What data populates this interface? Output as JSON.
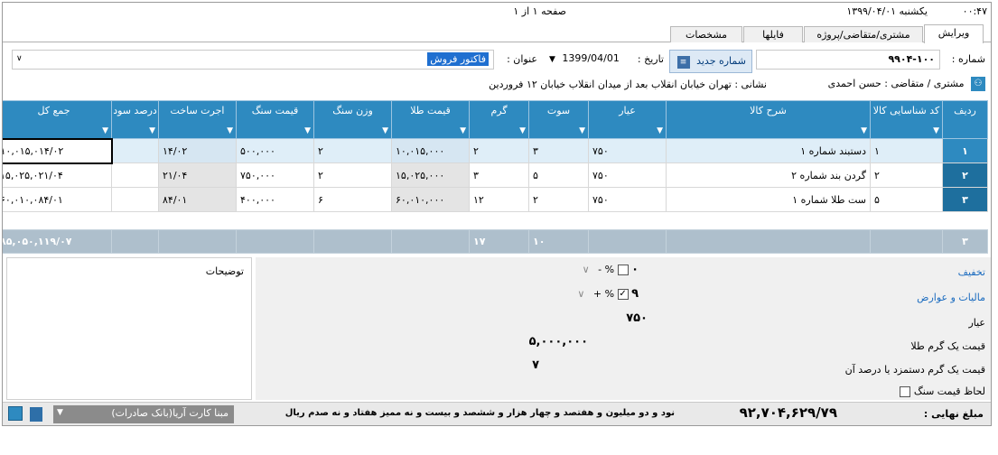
{
  "header": {
    "time": "۰۰:۴۷",
    "date": "یکشنبه ۱۳۹۹/۰۴/۰۱",
    "pager": "صفحه ۱ از ۱"
  },
  "tabs": [
    {
      "label": "ویرایش",
      "active": true
    },
    {
      "label": "مشتری/متقاضی/پروژه",
      "active": false
    },
    {
      "label": "فایلها",
      "active": false
    },
    {
      "label": "مشخصات",
      "active": false
    }
  ],
  "form": {
    "number_label": "شماره :",
    "number_value": "۹۹۰۴-۱۰۰",
    "new_number_button": "شماره جدید",
    "date_label": "تاریخ :",
    "date_value": "1399/04/01",
    "title_label": "عنوان :",
    "title_value": "فاکتور فروش",
    "customer_label": "مشتری / متقاضی : حسن احمدی",
    "address": "نشانی : تهران خیابان انقلاب بعد از میدان انقلاب خیابان ۱۲ فروردین"
  },
  "table": {
    "columns": [
      "ردیف",
      "کد شناسایی کالا",
      "شرح کالا",
      "عیار",
      "سوت",
      "گرم",
      "قیمت طلا",
      "وزن سنگ",
      "قیمت سنگ",
      "اجرت ساخت",
      "درصد سود",
      "جمع کل"
    ],
    "rows": [
      {
        "idx": "۱",
        "code": "۱",
        "desc": "دستبند شماره ۱",
        "ayar": "۷۵۰",
        "sot": "۳",
        "gram": "۲",
        "gold_price": "۱۰,۰۱۵,۰۰۰",
        "stone_weight": "۲",
        "stone_price": "۵۰۰,۰۰۰",
        "wage": "۱۴/۰۲",
        "profit": "",
        "total": "۱۰,۰۱۵,۰۱۴/۰۲"
      },
      {
        "idx": "۲",
        "code": "۲",
        "desc": "گردن بند شماره ۲",
        "ayar": "۷۵۰",
        "sot": "۵",
        "gram": "۳",
        "gold_price": "۱۵,۰۲۵,۰۰۰",
        "stone_weight": "۲",
        "stone_price": "۷۵۰,۰۰۰",
        "wage": "۲۱/۰۴",
        "profit": "",
        "total": "۱۵,۰۲۵,۰۲۱/۰۴"
      },
      {
        "idx": "۳",
        "code": "۵",
        "desc": "ست طلا شماره ۱",
        "ayar": "۷۵۰",
        "sot": "۲",
        "gram": "۱۲",
        "gold_price": "۶۰,۰۱۰,۰۰۰",
        "stone_weight": "۶",
        "stone_price": "۴۰۰,۰۰۰",
        "wage": "۸۴/۰۱",
        "profit": "",
        "total": "۶۰,۰۱۰,۰۸۴/۰۱"
      }
    ],
    "summary": {
      "count": "۳",
      "sot": "۱۰",
      "gram": "۱۷",
      "total": "۸۵,۰۵۰,۱۱۹/۰۷"
    }
  },
  "bottom": {
    "notes_label": "توضیحات",
    "discount_label": "تخفیف",
    "discount_value": "۰",
    "tax_label": "مالیات و عوارض",
    "tax_value": "۹",
    "percent_sign": "%",
    "minus_sign": "-",
    "plus_sign": "+",
    "ayar_label": "عیار",
    "ayar_value": "۷۵۰",
    "gold_gram_label": "قیمت یک گرم طلا",
    "gold_gram_value": "۵,۰۰۰,۰۰۰",
    "wage_pct_label": "قیمت یک گرم دستمزد یا درصد آن",
    "wage_pct_value": "۷",
    "stone_price_check_label": "لحاظ قیمت سنگ"
  },
  "status": {
    "bank": "مبنا کارت آریا(بانک صادرات)",
    "words": "نود و دو میلیون و هفتصد و  چهار هزار و ششصد و بیست و نه ممیز هفتاد و نه صدم ریال",
    "final_value": "۹۲,۷۰۴,۶۲۹/۷۹",
    "final_label": "مبلغ نهایی :"
  }
}
